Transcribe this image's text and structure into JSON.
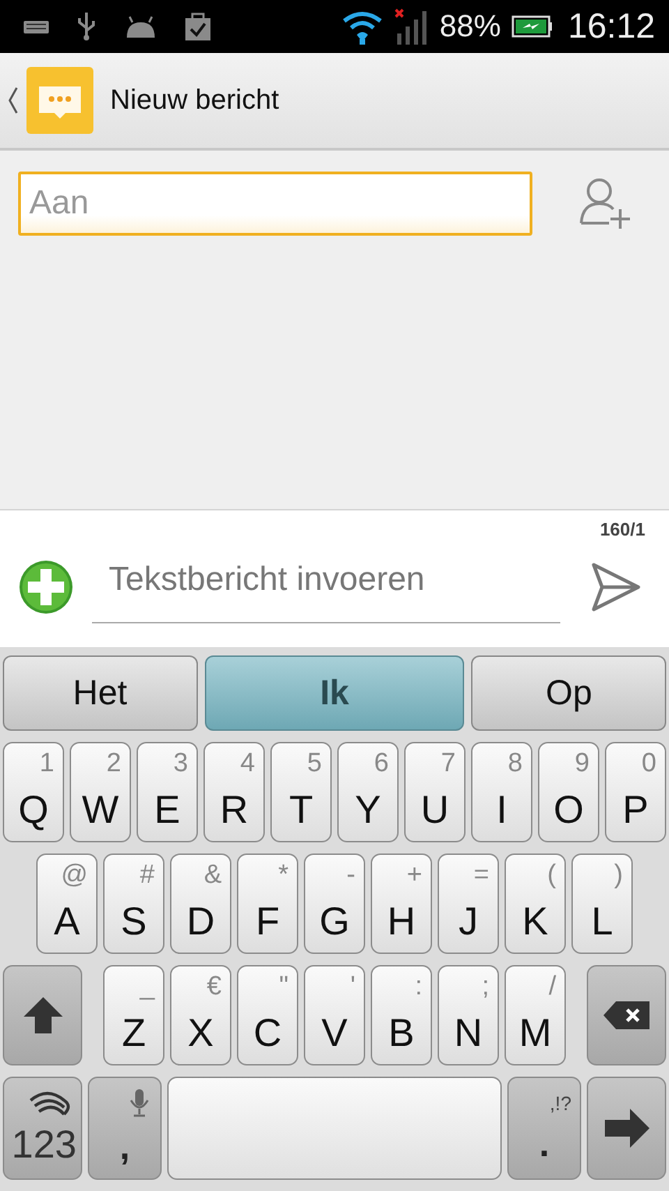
{
  "status_bar": {
    "battery": "88%",
    "time": "16:12"
  },
  "header": {
    "title": "Nieuw bericht"
  },
  "recipient_field": {
    "placeholder": "Aan"
  },
  "compose": {
    "counter": "160/1",
    "placeholder": "Tekstbericht invoeren"
  },
  "suggestions": [
    {
      "label": "Het",
      "selected": false
    },
    {
      "label": "Ik",
      "selected": true
    },
    {
      "label": "Op",
      "selected": false
    }
  ],
  "keyboard_rows": [
    [
      {
        "kind": "letter",
        "label": "Q",
        "hint": "1"
      },
      {
        "kind": "letter",
        "label": "W",
        "hint": "2"
      },
      {
        "kind": "letter",
        "label": "E",
        "hint": "3"
      },
      {
        "kind": "letter",
        "label": "R",
        "hint": "4"
      },
      {
        "kind": "letter",
        "label": "T",
        "hint": "5"
      },
      {
        "kind": "letter",
        "label": "Y",
        "hint": "6"
      },
      {
        "kind": "letter",
        "label": "U",
        "hint": "7"
      },
      {
        "kind": "letter",
        "label": "I",
        "hint": "8"
      },
      {
        "kind": "letter",
        "label": "O",
        "hint": "9"
      },
      {
        "kind": "letter",
        "label": "P",
        "hint": "0"
      }
    ],
    [
      {
        "kind": "letter",
        "label": "A",
        "hint": "@"
      },
      {
        "kind": "letter",
        "label": "S",
        "hint": "#"
      },
      {
        "kind": "letter",
        "label": "D",
        "hint": "&"
      },
      {
        "kind": "letter",
        "label": "F",
        "hint": "*"
      },
      {
        "kind": "letter",
        "label": "G",
        "hint": "-"
      },
      {
        "kind": "letter",
        "label": "H",
        "hint": "+"
      },
      {
        "kind": "letter",
        "label": "J",
        "hint": "="
      },
      {
        "kind": "letter",
        "label": "K",
        "hint": "("
      },
      {
        "kind": "letter",
        "label": "L",
        "hint": ")"
      }
    ],
    [
      {
        "kind": "shift"
      },
      {
        "kind": "letter",
        "label": "Z",
        "hint": "_"
      },
      {
        "kind": "letter",
        "label": "X",
        "hint": "€"
      },
      {
        "kind": "letter",
        "label": "C",
        "hint": "\""
      },
      {
        "kind": "letter",
        "label": "V",
        "hint": "'"
      },
      {
        "kind": "letter",
        "label": "B",
        "hint": ":"
      },
      {
        "kind": "letter",
        "label": "N",
        "hint": ";"
      },
      {
        "kind": "letter",
        "label": "M",
        "hint": "/"
      },
      {
        "kind": "delete"
      }
    ],
    [
      {
        "kind": "symbols",
        "label": "123"
      },
      {
        "kind": "mic",
        "label": ","
      },
      {
        "kind": "space"
      },
      {
        "kind": "punct",
        "label": ".",
        "hint": ",!?"
      },
      {
        "kind": "enter"
      }
    ]
  ]
}
